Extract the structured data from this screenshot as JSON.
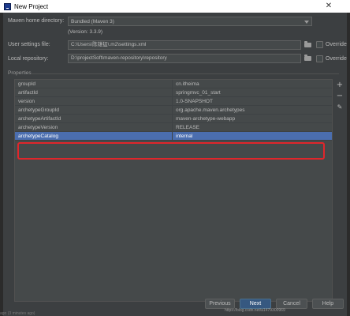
{
  "window": {
    "title": "New Project",
    "close_glyph": "✕"
  },
  "form": {
    "maven_home": {
      "label": "Maven home directory:",
      "value": "Bundled (Maven 3)"
    },
    "version_text": "(Version: 3.3.9)",
    "user_settings": {
      "label": "User settings file:",
      "value": "C:\\Users\\陈雄猛\\.m2\\settings.xml",
      "override_label": "Override"
    },
    "local_repo": {
      "label": "Local repository:",
      "value": "D:\\projectSoft\\maven-repository\\repository",
      "override_label": "Override"
    }
  },
  "properties": {
    "section_label": "Properties",
    "rows": [
      {
        "key": "groupId",
        "value": "cn.itheima"
      },
      {
        "key": "artifactId",
        "value": "springmvc_01_start"
      },
      {
        "key": "version",
        "value": "1.0-SNAPSHOT"
      },
      {
        "key": "archetypeGroupId",
        "value": "org.apache.maven.archetypes"
      },
      {
        "key": "archetypeArtifactId",
        "value": "maven-archetype-webapp"
      },
      {
        "key": "archetypeVersion",
        "value": "RELEASE"
      },
      {
        "key": "archetypeCatalog",
        "value": "internal"
      }
    ],
    "selected_index": 6,
    "tools": {
      "add": "+",
      "remove": "−",
      "edit": "✎"
    }
  },
  "buttons": {
    "previous": "Previous",
    "next": "Next",
    "cancel": "Cancel",
    "help": "Help"
  },
  "footer": {
    "watermark": "https://blog.csdn.net/a1479300969",
    "left_text": "ago (3 minutes ago)"
  },
  "colors": {
    "dialog_bg": "#3c3f41",
    "selection": "#4b6eaf",
    "highlight_box": "#e0262b",
    "primary_button": "#365880"
  }
}
